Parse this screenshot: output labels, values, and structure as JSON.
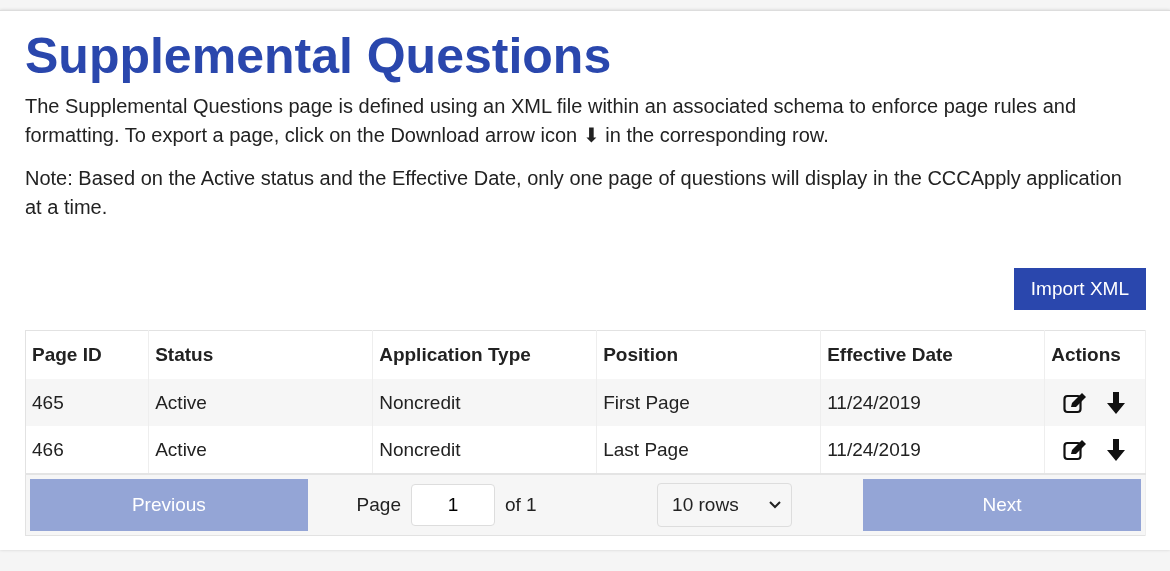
{
  "title": "Supplemental Questions",
  "intro": "The Supplemental Questions page is defined using an XML file within an associated schema to enforce page rules and formatting. To export a page, click on the Download arrow icon ⬇ in the corresponding row.",
  "note": "Note: Based on the Active status and the Effective Date, only one page of questions will display in the CCCApply application at a time.",
  "import_button": "Import XML",
  "table": {
    "columns": [
      "Page ID",
      "Status",
      "Application Type",
      "Position",
      "Effective Date",
      "Actions"
    ],
    "rows": [
      {
        "cells": [
          "465",
          "Active",
          "Noncredit",
          "First Page",
          "11/24/2019"
        ]
      },
      {
        "cells": [
          "466",
          "Active",
          "Noncredit",
          "Last Page",
          "11/24/2019"
        ]
      }
    ]
  },
  "pagination": {
    "previous": {
      "label": "Previous",
      "disabled": true
    },
    "page_label": "Page",
    "page_value": "1",
    "of_label": "of 1",
    "rows_select": "10 rows",
    "next": {
      "label": "Next",
      "disabled": true
    }
  }
}
